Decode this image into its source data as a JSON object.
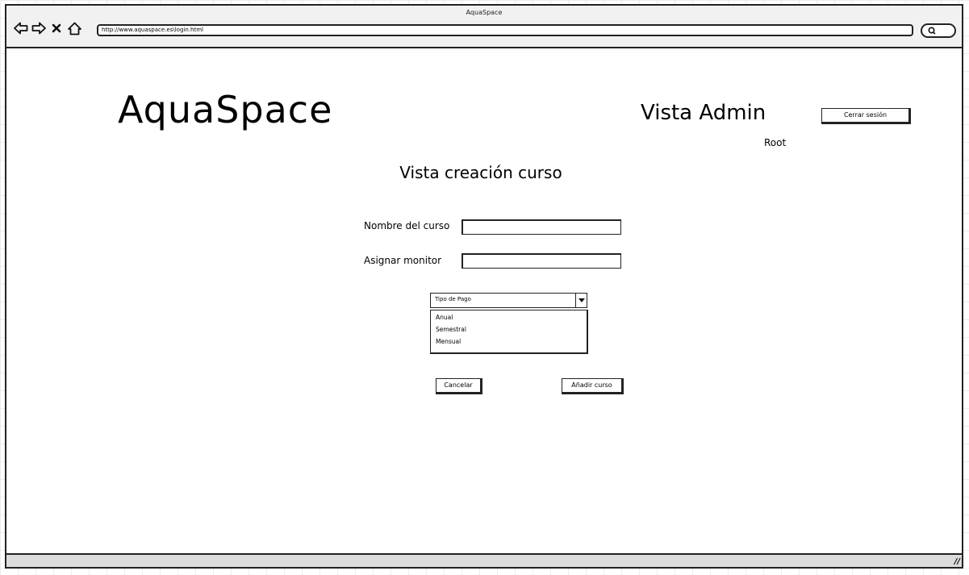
{
  "window": {
    "title": "AquaSpace"
  },
  "browser": {
    "url": "http://www.aquaspace.es\\login.html",
    "icons": [
      "back-arrow-icon",
      "forward-arrow-icon",
      "stop-icon",
      "home-icon",
      "search-icon"
    ]
  },
  "header": {
    "logo": "AquaSpace",
    "view_title": "Vista Admin",
    "user": "Root",
    "logout_label": "Cerrar sesión"
  },
  "form": {
    "heading": "Vista creación curso",
    "course_name_label": "Nombre del curso",
    "course_name_value": "",
    "monitor_label": "Asignar monitor",
    "monitor_value": "",
    "payment_select": {
      "selected": "Tipo de Pago",
      "options": [
        "Anual",
        "Semestral",
        "Mensual"
      ]
    },
    "cancel_label": "Cancelar",
    "submit_label": "Añadir curso"
  }
}
